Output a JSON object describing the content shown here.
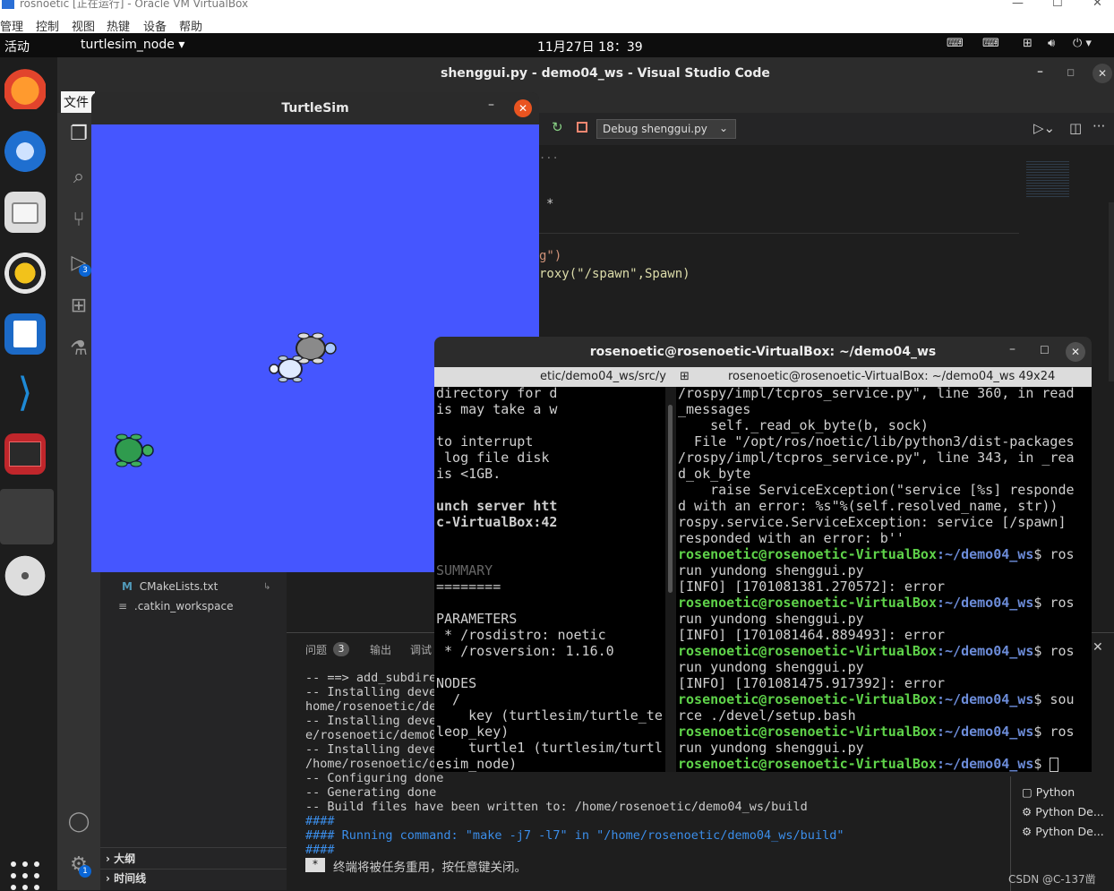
{
  "vbox": {
    "title": "rosnoetic [正在运行] - Oracle VM VirtualBox",
    "menu": [
      "管理",
      "控制",
      "视图",
      "热键",
      "设备",
      "帮助"
    ]
  },
  "topbar": {
    "activities": "活动",
    "app_menu": "turtlesim_node ▾",
    "clock": "11月27日  18：39"
  },
  "vscode": {
    "title": "shenggui.py - demo04_ws - Visual Studio Code",
    "menu_file": "文件",
    "debug_config": "Debug shenggui.py",
    "code_fragments": [
      "g\")",
      "roxy(\"/spawn\",Spawn)",
      "*",
      "..."
    ],
    "sidebar_items": [
      "CMakeLists.txt",
      ".catkin_workspace"
    ],
    "outline": "大纲",
    "timeline": "时间线",
    "run_badge": "3",
    "settings_badge": "1",
    "panel_tabs": {
      "problems": "问题",
      "problems_count": "3",
      "output": "输出",
      "debug": "调试"
    },
    "panel_lines": [
      "-- ==> add_subdire",
      "-- Installing deve",
      "home/rosenoetic/de",
      "-- Installing deve",
      "e/rosenoetic/demo0",
      "-- Installing deve",
      "/home/rosenoetic/de",
      "-- Configuring done",
      "-- Generating done",
      "-- Build files have been written to: /home/rosenoetic/demo04_ws/build",
      "####",
      "#### Running command: \"make -j7 -l7\" in \"/home/rosenoetic/demo04_ws/build\"",
      "####"
    ],
    "terminal_reuse_msg": "终端将被任务重用，按任意键关闭。",
    "terminal_list": [
      "Python",
      "Python De...",
      "Python De..."
    ]
  },
  "turtlesim": {
    "title": "TurtleSim"
  },
  "terminal": {
    "title": "rosenoetic@rosenoetic-VirtualBox: ~/demo04_ws",
    "tab_left": "etic/demo04_ws/src/y",
    "tab_right": "rosenoetic@rosenoetic-VirtualBox: ~/demo04_ws 49x24",
    "left_lines": [
      "directory for d",
      "is may take a w",
      "",
      "to interrupt",
      " log file disk",
      "is <1GB.",
      "",
      "unch server htt",
      "c-VirtualBox:42",
      "",
      "",
      "SUMMARY",
      "========",
      "",
      "PARAMETERS",
      " * /rosdistro: noetic",
      " * /rosversion: 1.16.0",
      "",
      "NODES",
      "  /",
      "    key (turtlesim/turtle_te",
      "leop_key)",
      "    turtle1 (turtlesim/turtl",
      "esim_node)"
    ],
    "right_plain_lines": [
      "/rospy/impl/tcpros_service.py\", line 360, in read",
      "_messages",
      "    self._read_ok_byte(b, sock)",
      "  File \"/opt/ros/noetic/lib/python3/dist-packages",
      "/rospy/impl/tcpros_service.py\", line 343, in _rea",
      "d_ok_byte",
      "    raise ServiceException(\"service [%s] responde",
      "d with an error: %s\"%(self.resolved_name, str))",
      "rospy.service.ServiceException: service [/spawn]",
      "responded with an error: b''"
    ],
    "prompt_user": "rosenoetic@rosenoetic-VirtualBox",
    "prompt_path": ":~/demo04_ws",
    "prompt_sign": "$",
    "cmd_ros": " ros",
    "cmd_run": "run yundong shenggui.py",
    "info_1": "[INFO] [1701081381.270572]: error",
    "info_2": "[INFO] [1701081464.889493]: error",
    "info_3": "[INFO] [1701081475.917392]: error",
    "cmd_sou": " sou",
    "cmd_source": "rce ./devel/setup.bash"
  },
  "watermark": "CSDN @C-137凿"
}
